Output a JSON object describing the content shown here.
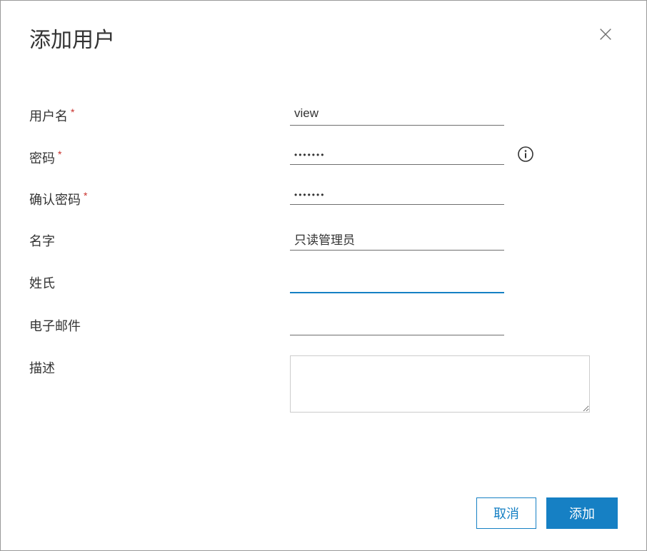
{
  "dialog": {
    "title": "添加用户"
  },
  "form": {
    "username": {
      "label": "用户名",
      "value": "view",
      "required": true
    },
    "password": {
      "label": "密码",
      "value": "•••••••",
      "required": true
    },
    "confirmPassword": {
      "label": "确认密码",
      "value": "•••••••",
      "required": true
    },
    "firstName": {
      "label": "名字",
      "value": "只读管理员",
      "required": false
    },
    "lastName": {
      "label": "姓氏",
      "value": "",
      "required": false
    },
    "email": {
      "label": "电子邮件",
      "value": "",
      "required": false
    },
    "description": {
      "label": "描述",
      "value": "",
      "required": false
    },
    "requiredMark": "*"
  },
  "buttons": {
    "cancel": "取消",
    "submit": "添加"
  }
}
